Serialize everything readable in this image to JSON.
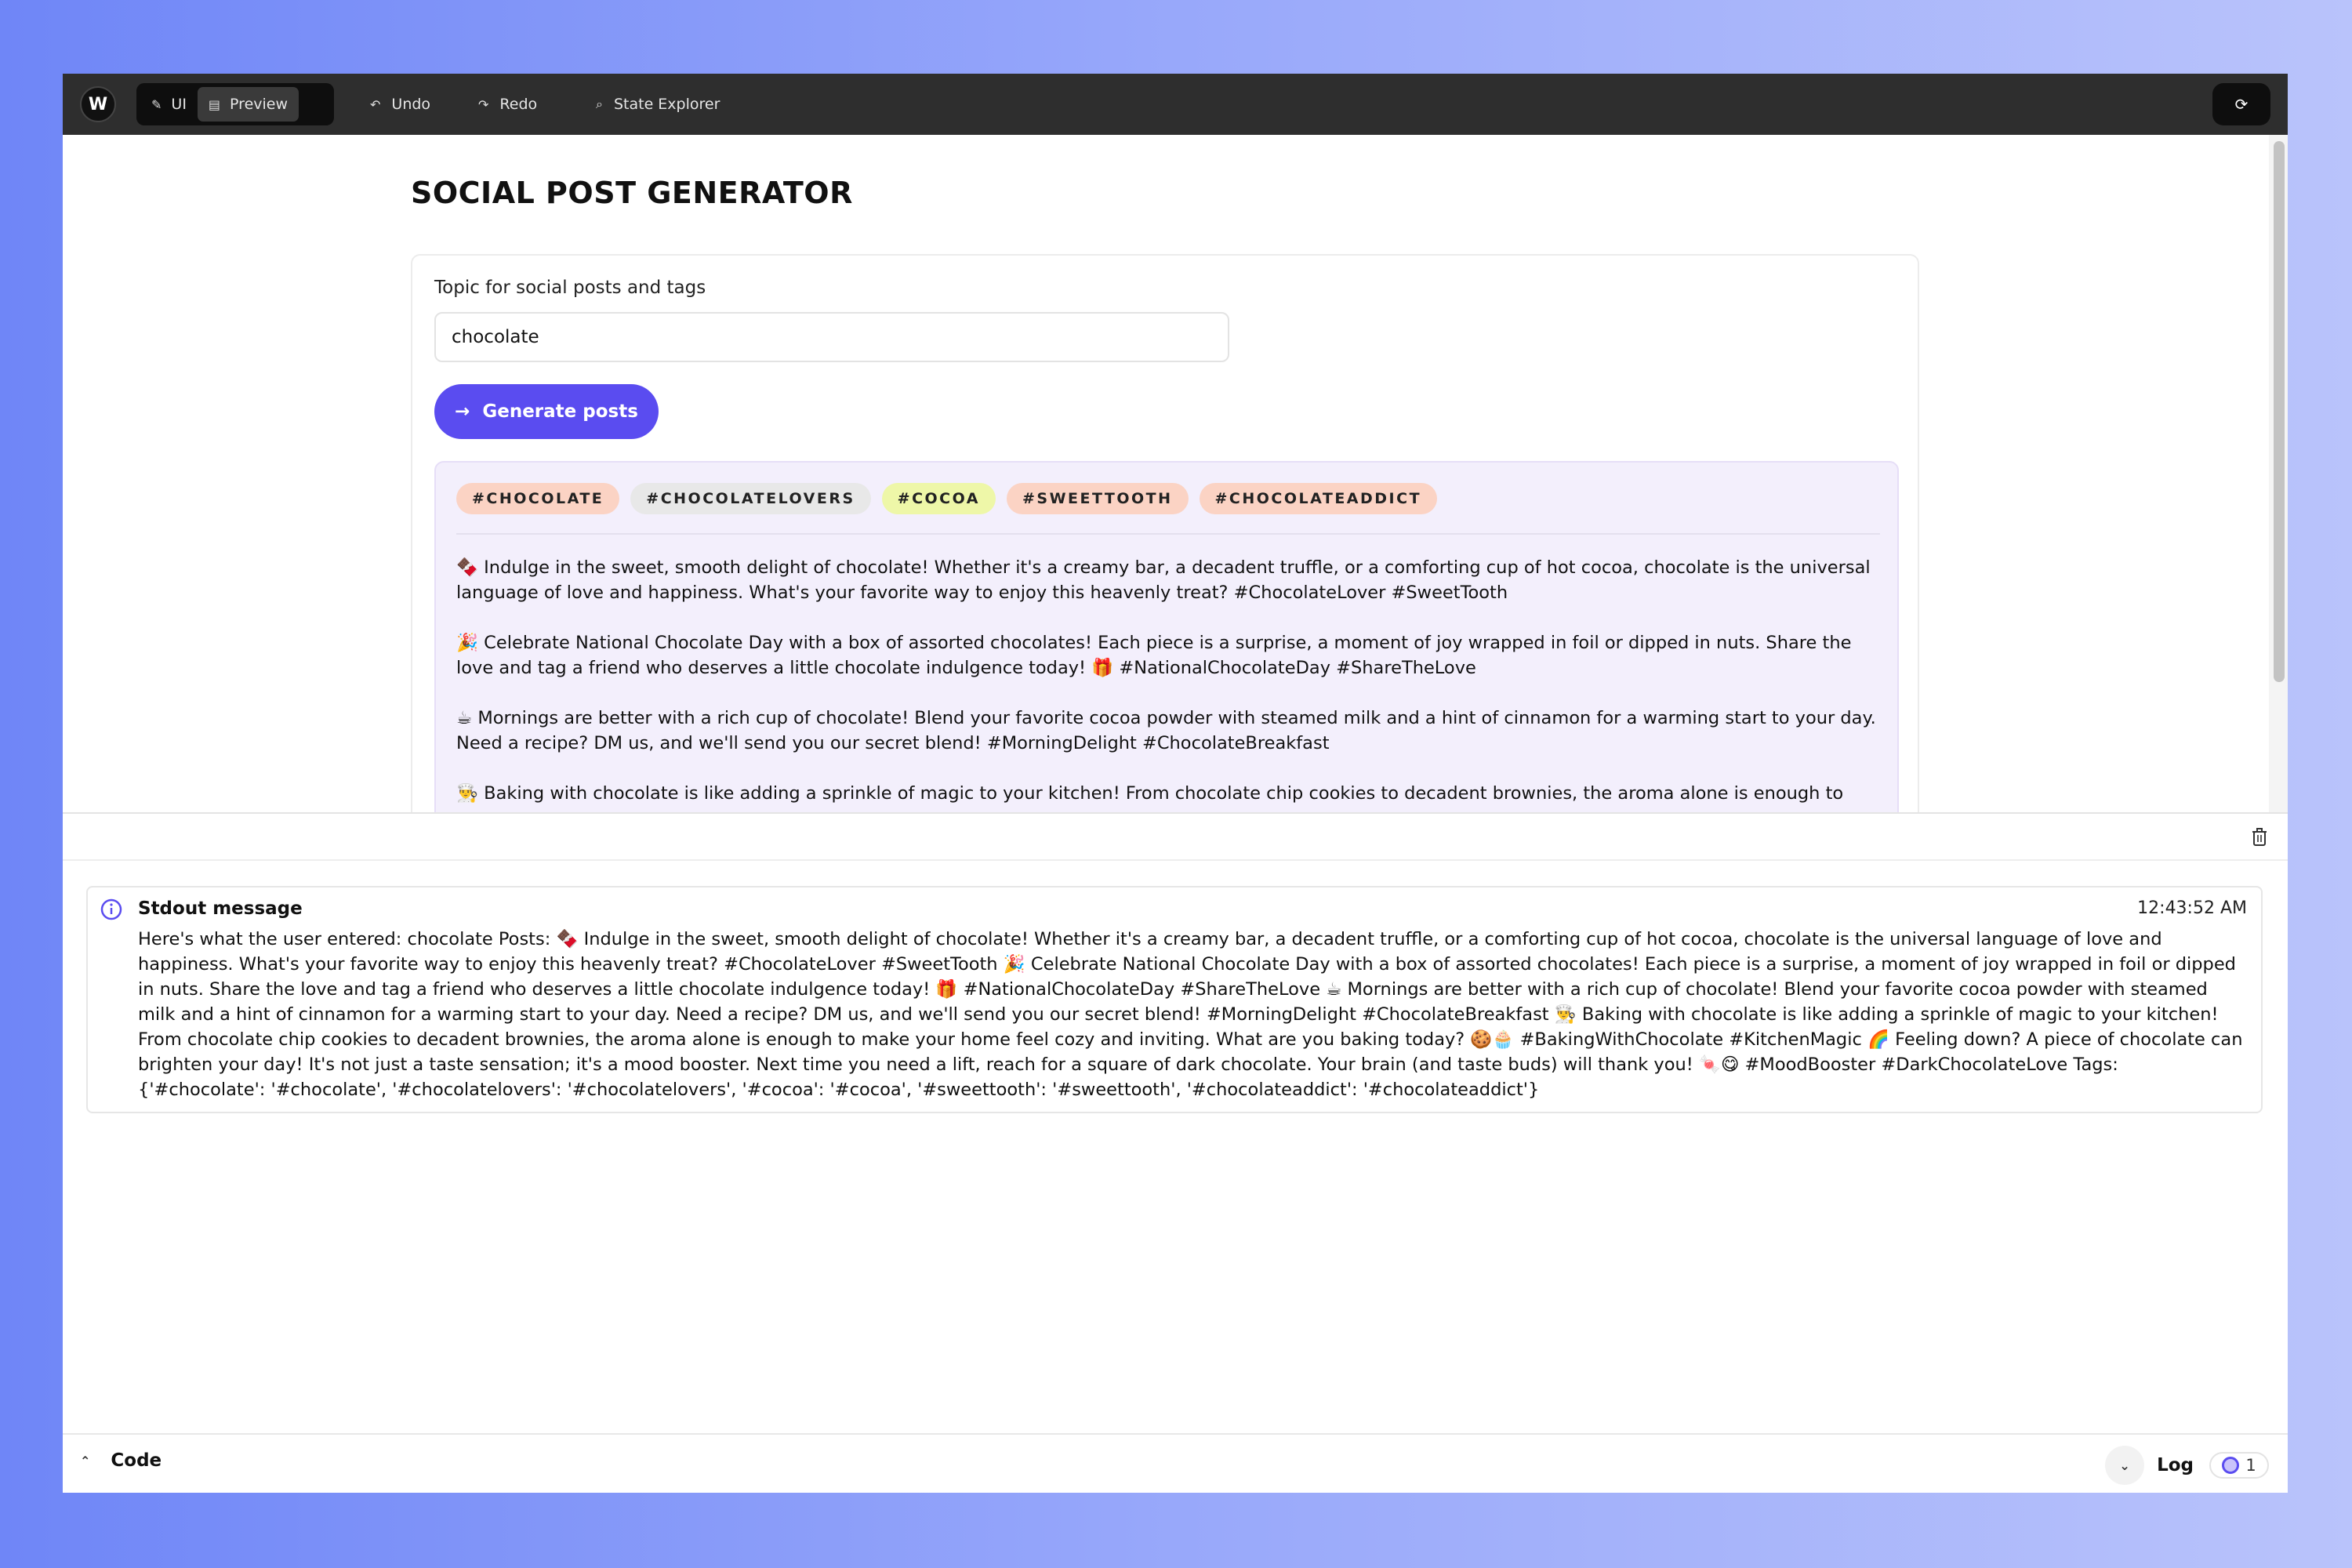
{
  "toolbar": {
    "logo_text": "W",
    "mode_ui": "UI",
    "mode_preview": "Preview",
    "undo": "Undo",
    "redo": "Redo",
    "state_explorer": "State Explorer"
  },
  "page": {
    "title": "SOCIAL POST GENERATOR",
    "input_label": "Topic for social posts and tags",
    "input_value": "chocolate",
    "generate_button": "Generate posts"
  },
  "tags": [
    {
      "label": "#CHOCOLATE",
      "color": "#fbd3c4"
    },
    {
      "label": "#CHOCOLATELOVERS",
      "color": "#e8e8e8"
    },
    {
      "label": "#COCOA",
      "color": "#eef7a8"
    },
    {
      "label": "#SWEETTOOTH",
      "color": "#fbd3c4"
    },
    {
      "label": "#CHOCOLATEADDICT",
      "color": "#fbd3c4"
    }
  ],
  "posts": [
    "🍫 Indulge in the sweet, smooth delight of chocolate! Whether it's a creamy bar, a decadent truffle, or a comforting cup of hot cocoa, chocolate is the universal language of love and happiness. What's your favorite way to enjoy this heavenly treat? #ChocolateLover #SweetTooth",
    "🎉 Celebrate National Chocolate Day with a box of assorted chocolates! Each piece is a surprise, a moment of joy wrapped in foil or dipped in nuts. Share the love and tag a friend who deserves a little chocolate indulgence today! 🎁 #NationalChocolateDay #ShareTheLove",
    "☕ Mornings are better with a rich cup of chocolate! Blend your favorite cocoa powder with steamed milk and a hint of cinnamon for a warming start to your day. Need a recipe? DM us, and we'll send you our secret blend! #MorningDelight #ChocolateBreakfast",
    "👨‍🍳 Baking with chocolate is like adding a sprinkle of magic to your kitchen! From chocolate chip cookies to decadent brownies, the aroma alone is enough to"
  ],
  "log": {
    "title": "Stdout message",
    "time": "12:43:52 AM",
    "body": "Here's what the user entered: chocolate Posts: 🍫 Indulge in the sweet, smooth delight of chocolate! Whether it's a creamy bar, a decadent truffle, or a comforting cup of hot cocoa, chocolate is the universal language of love and happiness. What's your favorite way to enjoy this heavenly treat? #ChocolateLover #SweetTooth 🎉 Celebrate National Chocolate Day with a box of assorted chocolates! Each piece is a surprise, a moment of joy wrapped in foil or dipped in nuts. Share the love and tag a friend who deserves a little chocolate indulgence today! 🎁 #NationalChocolateDay #ShareTheLove ☕ Mornings are better with a rich cup of chocolate! Blend your favorite cocoa powder with steamed milk and a hint of cinnamon for a warming start to your day. Need a recipe? DM us, and we'll send you our secret blend! #MorningDelight #ChocolateBreakfast 👨‍🍳 Baking with chocolate is like adding a sprinkle of magic to your kitchen! From chocolate chip cookies to decadent brownies, the aroma alone is enough to make your home feel cozy and inviting. What are you baking today? 🍪🧁 #BakingWithChocolate #KitchenMagic 🌈 Feeling down? A piece of chocolate can brighten your day! It's not just a taste sensation; it's a mood booster. Next time you need a lift, reach for a square of dark chocolate. Your brain (and taste buds) will thank you! 🍬😋 #MoodBooster #DarkChocolateLove Tags: {'#chocolate': '#chocolate', '#chocolatelovers': '#chocolatelovers', '#cocoa': '#cocoa', '#sweettooth': '#sweettooth', '#chocolateaddict': '#chocolateaddict'}"
  },
  "bottom": {
    "code": "Code",
    "log": "Log",
    "log_count": "1"
  },
  "colors": {
    "accent": "#5a4cf0",
    "toolbar_bg": "#2e2e2e",
    "results_bg": "#f3effc"
  },
  "icons": [
    "pencil-icon",
    "preview-icon",
    "undo-icon",
    "redo-icon",
    "search-icon",
    "sync-icon",
    "arrow-right-icon",
    "trash-icon",
    "info-icon",
    "chevron-up-icon",
    "chevron-down-icon"
  ]
}
